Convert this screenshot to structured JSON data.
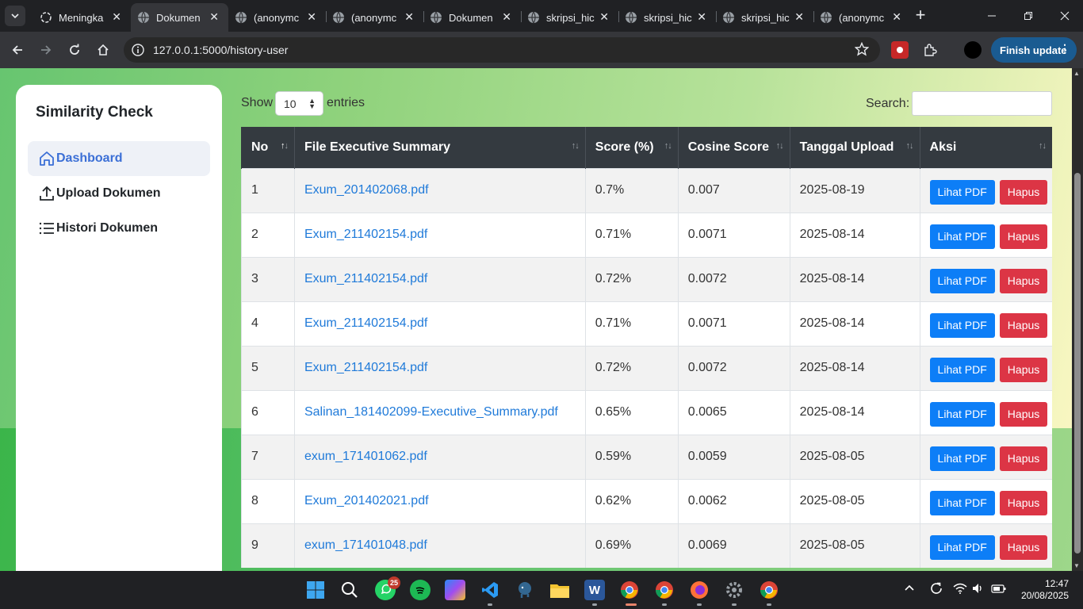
{
  "browser": {
    "tabs": [
      {
        "title": "Meningka",
        "icon": "chatgpt-icon",
        "active": false
      },
      {
        "title": "Dokumen",
        "icon": "globe-icon",
        "active": true
      },
      {
        "title": "(anonymc",
        "icon": "globe-icon",
        "active": false
      },
      {
        "title": "(anonymc",
        "icon": "globe-icon",
        "active": false
      },
      {
        "title": "Dokumen",
        "icon": "globe-icon",
        "active": false
      },
      {
        "title": "skripsi_hic",
        "icon": "globe-icon",
        "active": false
      },
      {
        "title": "skripsi_hic",
        "icon": "globe-icon",
        "active": false
      },
      {
        "title": "skripsi_hic",
        "icon": "globe-icon",
        "active": false
      },
      {
        "title": "(anonymc",
        "icon": "globe-icon",
        "active": false
      }
    ],
    "url": "127.0.0.1:5000/history-user",
    "finish_update": "Finish update"
  },
  "sidebar": {
    "brand": "Similarity Check",
    "items": [
      {
        "label": "Dashboard",
        "icon": "home-icon",
        "active": true
      },
      {
        "label": "Upload Dokumen",
        "icon": "upload-icon",
        "active": false
      },
      {
        "label": "Histori Dokumen",
        "icon": "list-icon",
        "active": false
      }
    ]
  },
  "table_controls": {
    "show_label": "Show",
    "entries_value": "10",
    "entries_suffix": "entries",
    "search_label": "Search:",
    "search_value": ""
  },
  "table": {
    "headers": [
      "No",
      "File Executive Summary",
      "Score (%)",
      "Cosine Score",
      "Tanggal Upload",
      "Aksi"
    ],
    "view_label": "Lihat PDF",
    "delete_label": "Hapus",
    "rows": [
      {
        "no": "1",
        "file": "Exum_201402068.pdf",
        "score": "0.7%",
        "cosine": "0.007",
        "date": "2025-08-19"
      },
      {
        "no": "2",
        "file": "Exum_211402154.pdf",
        "score": "0.71%",
        "cosine": "0.0071",
        "date": "2025-08-14"
      },
      {
        "no": "3",
        "file": "Exum_211402154.pdf",
        "score": "0.72%",
        "cosine": "0.0072",
        "date": "2025-08-14"
      },
      {
        "no": "4",
        "file": "Exum_211402154.pdf",
        "score": "0.71%",
        "cosine": "0.0071",
        "date": "2025-08-14"
      },
      {
        "no": "5",
        "file": "Exum_211402154.pdf",
        "score": "0.72%",
        "cosine": "0.0072",
        "date": "2025-08-14"
      },
      {
        "no": "6",
        "file": "Salinan_181402099-Executive_Summary.pdf",
        "score": "0.65%",
        "cosine": "0.0065",
        "date": "2025-08-14"
      },
      {
        "no": "7",
        "file": "exum_171401062.pdf",
        "score": "0.59%",
        "cosine": "0.0059",
        "date": "2025-08-05"
      },
      {
        "no": "8",
        "file": "Exum_201402021.pdf",
        "score": "0.62%",
        "cosine": "0.0062",
        "date": "2025-08-05"
      },
      {
        "no": "9",
        "file": "exum_171401048.pdf",
        "score": "0.69%",
        "cosine": "0.0069",
        "date": "2025-08-05"
      }
    ]
  },
  "taskbar": {
    "whatsapp_badge": "25",
    "time": "12:47",
    "date": "20/08/2025"
  },
  "colors": {
    "primary": "#0d7ef7",
    "danger": "#dc3545",
    "header": "#343a40",
    "link": "#1f7ad9"
  }
}
